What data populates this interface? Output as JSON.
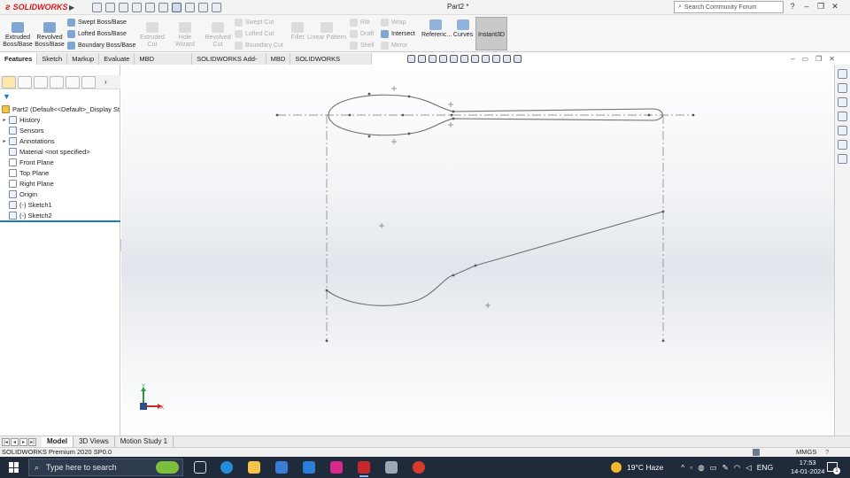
{
  "app": {
    "brand": "SOLIDWORKS",
    "document_title": "Part2 *"
  },
  "search": {
    "placeholder": "Search Community Forum"
  },
  "ribbon": {
    "extruded_boss": "Extruded Boss/Base",
    "revolved_boss": "Revolved Boss/Base",
    "swept_boss": "Swept Boss/Base",
    "lofted_boss": "Lofted Boss/Base",
    "boundary_boss": "Boundary Boss/Base",
    "extruded_cut": "Extruded Cut",
    "hole_wizard": "Hole Wizard",
    "revolved_cut": "Revolved Cut",
    "swept_cut": "Swept Cut",
    "lofted_cut": "Lofted Cut",
    "boundary_cut": "Boundary Cut",
    "fillet": "Fillet",
    "linear_pattern": "Linear Pattern",
    "rib": "Rib",
    "draft": "Draft",
    "shell": "Shell",
    "wrap": "Wrap",
    "intersect": "Intersect",
    "mirror": "Mirror",
    "reference": "Referenc...",
    "curves": "Curves",
    "instant3d": "Instant3D"
  },
  "command_tabs": [
    "Features",
    "Sketch",
    "Markup",
    "Evaluate",
    "MBD Dimensions",
    "SOLIDWORKS Add-Ins",
    "MBD",
    "SOLIDWORKS Inspection"
  ],
  "tree": {
    "root": "Part2  (Default<<Default>_Display St",
    "items": [
      {
        "label": "History",
        "expandable": true
      },
      {
        "label": "Sensors",
        "expandable": false
      },
      {
        "label": "Annotations",
        "expandable": true
      },
      {
        "label": "Material <not specified>",
        "expandable": false
      },
      {
        "label": "Front Plane",
        "expandable": false
      },
      {
        "label": "Top Plane",
        "expandable": false
      },
      {
        "label": "Right Plane",
        "expandable": false
      },
      {
        "label": "Origin",
        "expandable": false
      },
      {
        "label": "(-) Sketch1",
        "expandable": false
      },
      {
        "label": "(-) Sketch2",
        "expandable": false
      }
    ]
  },
  "triad": {
    "x": "X",
    "y": "Y"
  },
  "bottom_tabs": [
    "Model",
    "3D Views",
    "Motion Study 1"
  ],
  "status": {
    "product": "SOLIDWORKS Premium 2020 SP0.0",
    "units": "MMGS",
    "help": "?"
  },
  "taskbar": {
    "search_placeholder": "Type here to search",
    "weather": "19°C  Haze",
    "language": "ENG",
    "time": "17:53",
    "date": "14-01-2024",
    "notifications": "1"
  },
  "colors": {
    "brand_red": "#d71920",
    "selection_blue": "#1f78c8",
    "sketch_line": "#777777",
    "taskbar": "#1f2a3a"
  }
}
